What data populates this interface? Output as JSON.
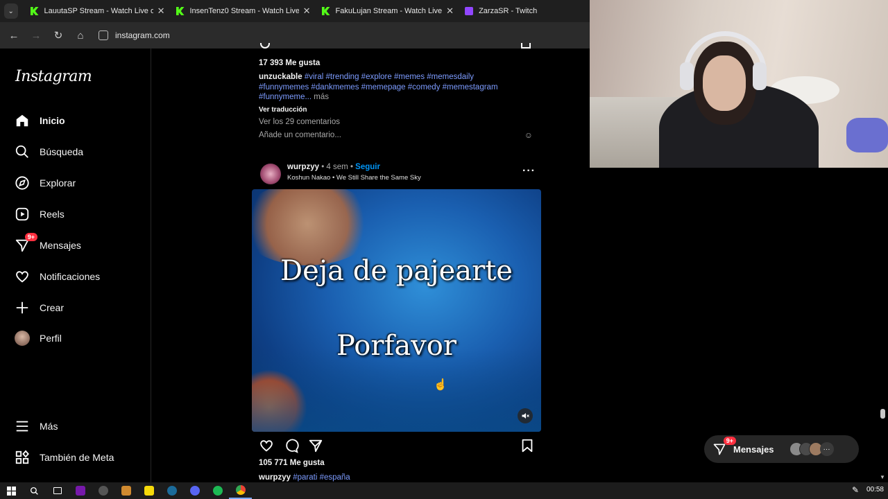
{
  "browser": {
    "tabs": [
      {
        "label": "LauutaSP Stream - Watch Live o",
        "icon": "kick-icon"
      },
      {
        "label": "InsenTenz0 Stream - Watch Live",
        "icon": "kick-icon"
      },
      {
        "label": "FakuLujan Stream - Watch Live",
        "icon": "kick-icon"
      },
      {
        "label": "ZarzaSR - Twitch",
        "icon": "twitch-icon"
      }
    ],
    "url": "instagram.com"
  },
  "sidebar": {
    "logo": "Instagram",
    "items": [
      {
        "label": "Inicio",
        "icon": "home-icon"
      },
      {
        "label": "Búsqueda",
        "icon": "search-icon"
      },
      {
        "label": "Explorar",
        "icon": "compass-icon"
      },
      {
        "label": "Reels",
        "icon": "reels-icon"
      },
      {
        "label": "Mensajes",
        "icon": "messenger-icon",
        "badge": "9+"
      },
      {
        "label": "Notificaciones",
        "icon": "heart-icon"
      },
      {
        "label": "Crear",
        "icon": "plus-icon"
      },
      {
        "label": "Perfil",
        "icon": "avatar-icon"
      },
      {
        "label": "Más",
        "icon": "menu-icon"
      },
      {
        "label": "También de Meta",
        "icon": "meta-icon"
      }
    ]
  },
  "post1": {
    "likes": "17 393 Me gusta",
    "username": "unzuckable",
    "caption_tags": "#viral #trending #explore #memes #memesdaily",
    "caption_tags2": "#funnymemes #dankmemes #memepage #comedy #memestagram",
    "caption_tags3": "#funnymeme...",
    "more": " más",
    "translate": "Ver traducción",
    "comments": "Ver los 29 comentarios",
    "add_comment": "Añade un comentario..."
  },
  "post2": {
    "username": "wurpzyy",
    "age": " • 4 sem • ",
    "follow": "Seguir",
    "audio": "Koshun Nakao • We Still Share the Same Sky",
    "overlay_line1": "Deja de pajearte",
    "overlay_line2": "Porfavor",
    "likes": "105 771 Me gusta",
    "caption_user": "wurpzyy",
    "caption_tags": "#parati #españa"
  },
  "dock": {
    "label": "Mensajes",
    "badge": "9+"
  },
  "taskbar": {
    "time": "00:58"
  }
}
